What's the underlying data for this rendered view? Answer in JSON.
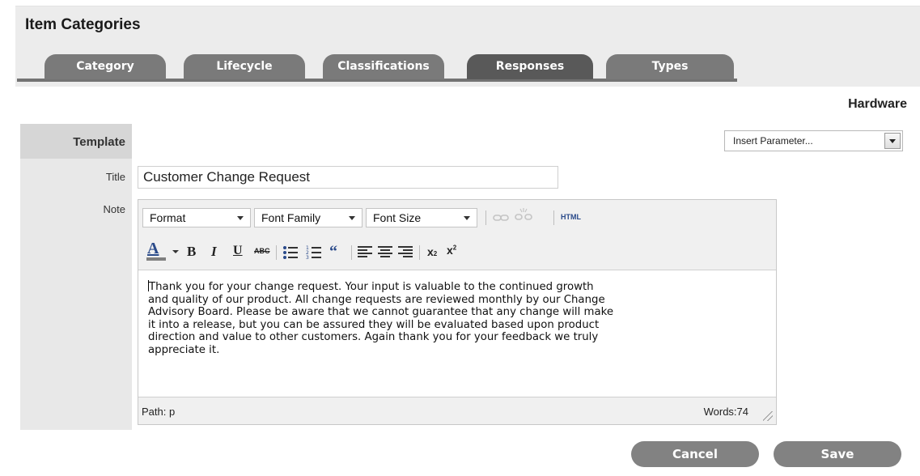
{
  "page": {
    "title": "Item Categories",
    "subject": "Hardware"
  },
  "tabs": [
    {
      "label": "Category",
      "active": false
    },
    {
      "label": "Lifecycle",
      "active": false
    },
    {
      "label": "Classifications",
      "active": false
    },
    {
      "label": "Responses",
      "active": true
    },
    {
      "label": "Types",
      "active": false
    }
  ],
  "form": {
    "section_label": "Template",
    "insert_parameter": "Insert Parameter...",
    "title_label": "Title",
    "title_value": "Customer Change Request",
    "note_label": "Note"
  },
  "editor": {
    "format_label": "Format",
    "font_family_label": "Font Family",
    "font_size_label": "Font Size",
    "html_label": "HTML",
    "content": [
      "Thank you for your change request. Your input is valuable to the continued growth",
      "and quality of our product. All change requests are reviewed monthly by our Change",
      "Advisory Board. Please be aware that we cannot guarantee that any change will make",
      "it into a release, but you can be assured they will be evaluated based upon product",
      "direction and value to other customers. Again thank you for your feedback we truly",
      "appreciate it."
    ],
    "path_text": "Path: p",
    "words_text": "Words:74"
  },
  "actions": {
    "cancel_label": "Cancel",
    "save_label": "Save"
  },
  "colors": {
    "tab": "#7a7a7a",
    "tab_active": "#595959",
    "button": "#828282",
    "header_bg": "#ececec"
  }
}
